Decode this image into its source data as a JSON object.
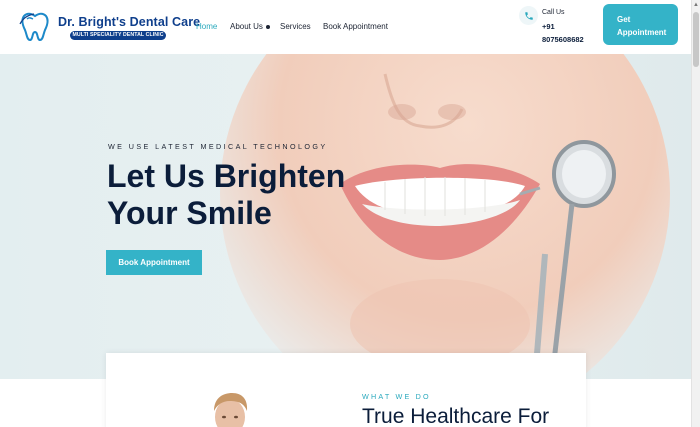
{
  "header": {
    "brand_title": "Dr. Bright's Dental Care",
    "brand_subtitle": "MULTI SPECIALITY DENTAL CLINIC",
    "nav": [
      {
        "label": "Home",
        "active": true
      },
      {
        "label": "About Us",
        "has_dropdown": true
      },
      {
        "label": "Services"
      },
      {
        "label": "Book Appointment"
      }
    ],
    "call": {
      "label": "Call Us",
      "number_line1": "+91",
      "number_line2": "8075608682",
      "icon": "phone-icon"
    },
    "cta_line1": "Get",
    "cta_line2": "Appointment"
  },
  "hero": {
    "kicker": "WE USE LATEST MEDICAL TECHNOLOGY",
    "title_line1": "Let Us Brighten",
    "title_line2": "Your Smile",
    "button_label": "Book Appointment"
  },
  "section": {
    "kicker": "WHAT WE DO",
    "title": "True Healthcare For"
  },
  "colors": {
    "accent": "#34b3c8",
    "brand": "#0f3f8c",
    "heading": "#0b1d3a"
  }
}
